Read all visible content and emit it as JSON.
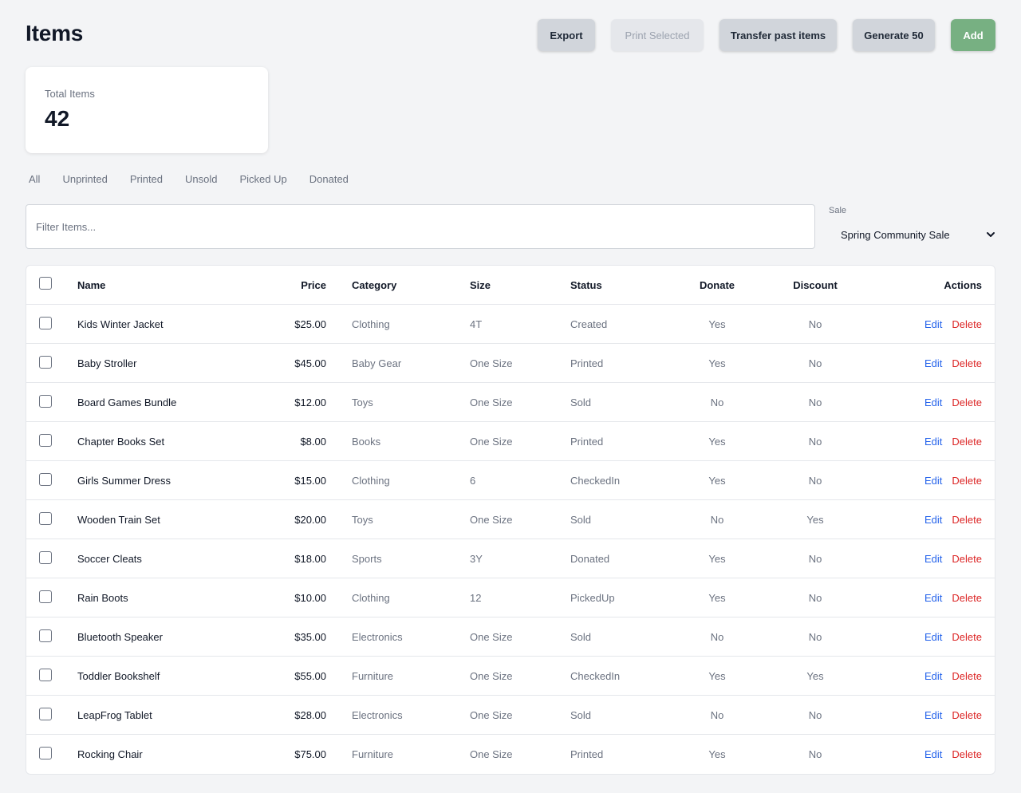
{
  "header": {
    "title": "Items",
    "buttons": {
      "export": "Export",
      "print_selected": "Print Selected",
      "transfer": "Transfer past items",
      "generate": "Generate 50",
      "add": "Add"
    }
  },
  "stats": {
    "label": "Total Items",
    "value": "42"
  },
  "filter_tabs": [
    "All",
    "Unprinted",
    "Printed",
    "Unsold",
    "Picked Up",
    "Donated"
  ],
  "filter": {
    "placeholder": "Filter Items..."
  },
  "sale": {
    "label": "Sale",
    "value": "Spring Community Sale"
  },
  "table": {
    "headers": {
      "name": "Name",
      "price": "Price",
      "category": "Category",
      "size": "Size",
      "status": "Status",
      "donate": "Donate",
      "discount": "Discount",
      "actions": "Actions"
    },
    "actions": {
      "edit": "Edit",
      "delete": "Delete"
    },
    "rows": [
      {
        "name": "Kids Winter Jacket",
        "price": "$25.00",
        "category": "Clothing",
        "size": "4T",
        "status": "Created",
        "donate": "Yes",
        "discount": "No"
      },
      {
        "name": "Baby Stroller",
        "price": "$45.00",
        "category": "Baby Gear",
        "size": "One Size",
        "status": "Printed",
        "donate": "Yes",
        "discount": "No"
      },
      {
        "name": "Board Games Bundle",
        "price": "$12.00",
        "category": "Toys",
        "size": "One Size",
        "status": "Sold",
        "donate": "No",
        "discount": "No"
      },
      {
        "name": "Chapter Books Set",
        "price": "$8.00",
        "category": "Books",
        "size": "One Size",
        "status": "Printed",
        "donate": "Yes",
        "discount": "No"
      },
      {
        "name": "Girls Summer Dress",
        "price": "$15.00",
        "category": "Clothing",
        "size": "6",
        "status": "CheckedIn",
        "donate": "Yes",
        "discount": "No"
      },
      {
        "name": "Wooden Train Set",
        "price": "$20.00",
        "category": "Toys",
        "size": "One Size",
        "status": "Sold",
        "donate": "No",
        "discount": "Yes"
      },
      {
        "name": "Soccer Cleats",
        "price": "$18.00",
        "category": "Sports",
        "size": "3Y",
        "status": "Donated",
        "donate": "Yes",
        "discount": "No"
      },
      {
        "name": "Rain Boots",
        "price": "$10.00",
        "category": "Clothing",
        "size": "12",
        "status": "PickedUp",
        "donate": "Yes",
        "discount": "No"
      },
      {
        "name": "Bluetooth Speaker",
        "price": "$35.00",
        "category": "Electronics",
        "size": "One Size",
        "status": "Sold",
        "donate": "No",
        "discount": "No"
      },
      {
        "name": "Toddler Bookshelf",
        "price": "$55.00",
        "category": "Furniture",
        "size": "One Size",
        "status": "CheckedIn",
        "donate": "Yes",
        "discount": "Yes"
      },
      {
        "name": "LeapFrog Tablet",
        "price": "$28.00",
        "category": "Electronics",
        "size": "One Size",
        "status": "Sold",
        "donate": "No",
        "discount": "No"
      },
      {
        "name": "Rocking Chair",
        "price": "$75.00",
        "category": "Furniture",
        "size": "One Size",
        "status": "Printed",
        "donate": "Yes",
        "discount": "No"
      }
    ]
  }
}
